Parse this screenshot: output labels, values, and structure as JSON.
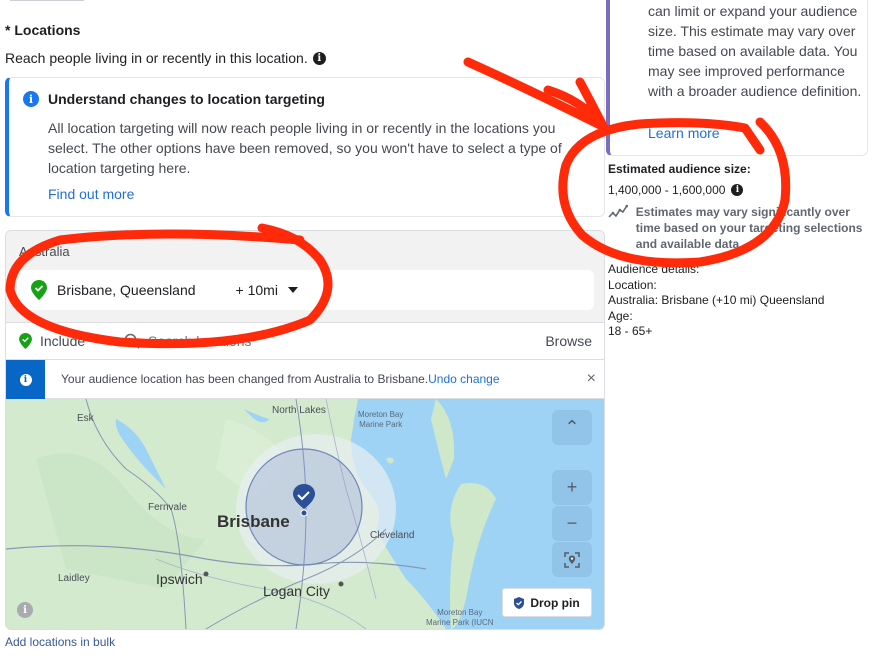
{
  "locations": {
    "title": "* Locations",
    "description": "Reach people living in or recently in this location."
  },
  "notice": {
    "title": "Understand changes to location targeting",
    "body": "All location targeting will now reach people living in or recently in the locations you select. The other options have been removed, so you won't have to select a type of location targeting here.",
    "link": "Find out more"
  },
  "location_box": {
    "country": "Australia",
    "selected": {
      "name": "Brisbane, Queensland",
      "radius": "+ 10mi"
    },
    "include_label": "Include",
    "search_placeholder": "Search locations",
    "browse_label": "Browse",
    "alert": {
      "text": "Your audience location has been changed from Australia to Brisbane.",
      "undo": "Undo change",
      "close": "×"
    }
  },
  "map": {
    "labels": {
      "esk": "Esk",
      "north_lakes": "North Lakes",
      "moreton_bay_1": "Moreton Bay",
      "marine_park_1": "Marine Park",
      "fernvale": "Fernvale",
      "brisbane": "Brisbane",
      "cleveland": "Cleveland",
      "laidley": "Laidley",
      "ipswich": "Ipswich",
      "logan_city": "Logan City",
      "moreton_bay_2": "Moreton Bay",
      "marine_park_2": "Marine Park (IUCN"
    },
    "controls": {
      "collapse": "⌃",
      "zoom_in": "+",
      "zoom_out": "−",
      "drop_pin": "Drop pin",
      "info": "i"
    }
  },
  "bulk_link": "Add locations in bulk",
  "side_card": {
    "text": "can limit or expand your audience size. This estimate may vary over time based on available data. You may see improved performance with a broader audience definition.",
    "link": "Learn more"
  },
  "estimate": {
    "title": "Estimated audience size:",
    "range": "1,400,000 - 1,600,000",
    "note": "Estimates may vary significantly over time based on your targeting selections and available data."
  },
  "audience_details": {
    "heading": "Audience details:",
    "location_label": "Location:",
    "location_value": "Australia: Brisbane (+10 mi) Queensland",
    "age_label": "Age:",
    "age_value": "18 - 65+"
  },
  "colors": {
    "accent_blue": "#1877f2",
    "link_blue": "#216fdb",
    "alert_blue": "#0866c6",
    "include_green": "#16a116",
    "side_accent": "#7c6cc4",
    "annotation_red": "#ff2a0a",
    "pin_blue": "#2d4f97"
  }
}
